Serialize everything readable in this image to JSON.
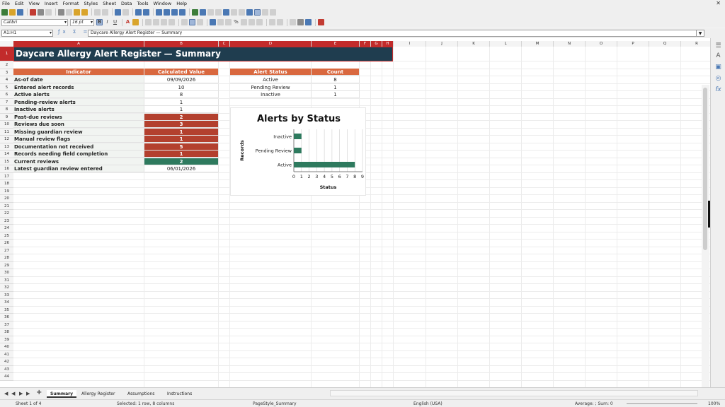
{
  "menu": [
    "File",
    "Edit",
    "View",
    "Insert",
    "Format",
    "Styles",
    "Sheet",
    "Data",
    "Tools",
    "Window",
    "Help"
  ],
  "toolbar": {
    "font_name": "Calibri",
    "font_size": "16 pt"
  },
  "formula_bar": {
    "name_box": "A1:H1",
    "content": "Daycare Allergy Alert Register — Summary"
  },
  "columns": [
    "A",
    "B",
    "C",
    "D",
    "E",
    "F",
    "G",
    "H",
    "I",
    "J",
    "K",
    "L",
    "M",
    "N",
    "O",
    "P",
    "Q",
    "R",
    "S",
    "T",
    "U"
  ],
  "rows": [
    "1",
    "2",
    "3",
    "4",
    "5",
    "6",
    "7",
    "8",
    "9",
    "10",
    "11",
    "12",
    "13",
    "14",
    "15",
    "16",
    "17",
    "18",
    "19",
    "20",
    "21",
    "22",
    "23",
    "24",
    "25",
    "26",
    "27",
    "28",
    "29",
    "30",
    "31",
    "32",
    "33",
    "34",
    "35",
    "36",
    "37",
    "38",
    "39",
    "40",
    "41",
    "42",
    "43",
    "44"
  ],
  "sheet": {
    "title": "Daycare Allergy Alert Register — Summary",
    "indicator_header": "Indicator",
    "value_header": "Calculated Value",
    "indicators": [
      {
        "label": "As-of date",
        "value": "09/09/2026",
        "style": "plain"
      },
      {
        "label": "Entered alert records",
        "value": "10",
        "style": "plain"
      },
      {
        "label": "Active alerts",
        "value": "8",
        "style": "plain"
      },
      {
        "label": "Pending-review alerts",
        "value": "1",
        "style": "plain"
      },
      {
        "label": "Inactive alerts",
        "value": "1",
        "style": "plain"
      },
      {
        "label": "Past-due reviews",
        "value": "2",
        "style": "red"
      },
      {
        "label": "Reviews due soon",
        "value": "3",
        "style": "red"
      },
      {
        "label": "Missing guardian review",
        "value": "1",
        "style": "red"
      },
      {
        "label": "Manual review flags",
        "value": "1",
        "style": "red"
      },
      {
        "label": "Documentation not received",
        "value": "5",
        "style": "red"
      },
      {
        "label": "Records needing field completion",
        "value": "1",
        "style": "red"
      },
      {
        "label": "Current reviews",
        "value": "2",
        "style": "green"
      },
      {
        "label": "Latest guardian review entered",
        "value": "06/01/2026",
        "style": "plain"
      }
    ],
    "status_header": "Alert Status",
    "count_header": "Count",
    "statuses": [
      {
        "status": "Active",
        "count": "8"
      },
      {
        "status": "Pending Review",
        "count": "1"
      },
      {
        "status": "Inactive",
        "count": "1"
      }
    ]
  },
  "chart_data": {
    "type": "bar",
    "orientation": "horizontal",
    "title": "Alerts by Status",
    "xlabel": "Status",
    "ylabel": "Records",
    "categories": [
      "Active",
      "Pending Review",
      "Inactive"
    ],
    "values": [
      8,
      1,
      1
    ],
    "xlim": [
      0,
      9
    ],
    "ticks": [
      "0",
      "1",
      "2",
      "3",
      "4",
      "5",
      "6",
      "7",
      "8",
      "9"
    ],
    "bar_color": "#2e7a5e",
    "grid": true
  },
  "tabs": [
    "Summary",
    "Allergy Register",
    "Assumptions",
    "Instructions"
  ],
  "status_bar": {
    "sheet_info": "Sheet 1 of 4",
    "selection": "Selected: 1 row, 8 columns",
    "page_style": "PageStyle_Summary",
    "language": "English (USA)",
    "summary": "Average: ; Sum: 0",
    "zoom": "100%"
  },
  "colors": {
    "title_band": "#1f3d4f",
    "header": "#d9683f",
    "alert": "#b3402e",
    "ok": "#2e7a5e",
    "selection": "#c22b2b"
  }
}
